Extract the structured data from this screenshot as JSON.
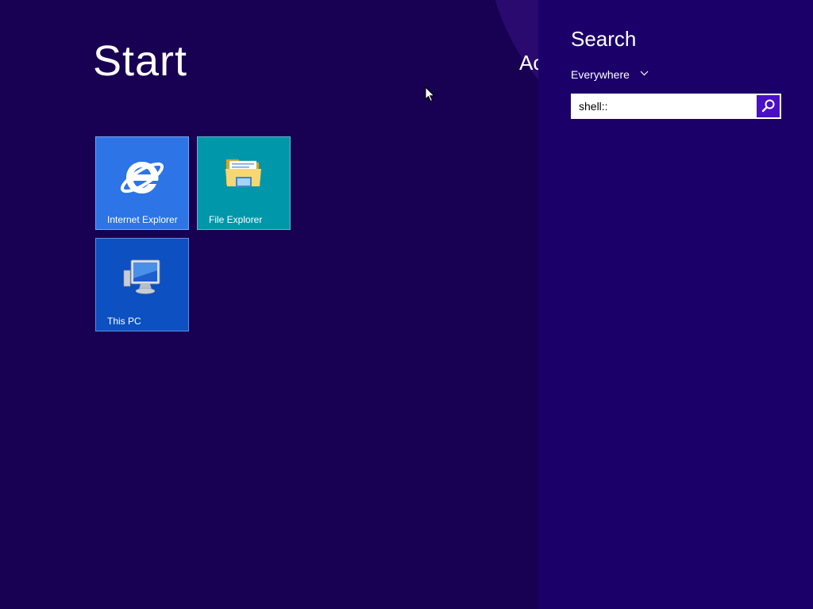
{
  "start": {
    "title": "Start",
    "user_name": "Ac"
  },
  "tiles": [
    {
      "label": "Internet Explorer",
      "icon": "internet-explorer-icon",
      "color": "#2d74e6"
    },
    {
      "label": "File Explorer",
      "icon": "folder-icon",
      "color": "#0097aa"
    },
    {
      "label": "This PC",
      "icon": "computer-icon",
      "color": "#0c50c2"
    }
  ],
  "search_charm": {
    "heading": "Search",
    "scope": "Everywhere",
    "query": "shell::",
    "button_icon": "search-icon"
  },
  "colors": {
    "background": "#180052",
    "charm_panel": "#1c006a",
    "search_button": "#4a10c6",
    "accent_arc": "#2a0a6e"
  }
}
